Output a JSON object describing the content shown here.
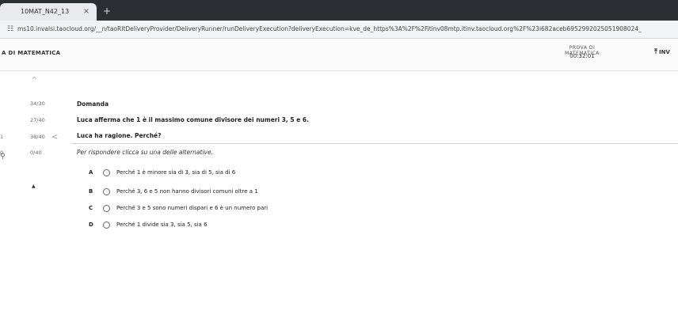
{
  "browser": {
    "tab_title": "10MAT_N42_13",
    "tab_close": "×",
    "new_tab": "+",
    "url": "ms10.invalsi.taocloud.org/__n/taoRItDeliveryProvider/DeliveryRunner/runDeliveryExecution?deliveryExecution=kve_de_https%3A%2F%2Fitinv08mtp.itinv.taocloud.org%2F%23i682aceb6952992025051908024_"
  },
  "app": {
    "title": "A DI MATEMATICA",
    "test_name": "PROVA DI MATEMATICA",
    "timer": "00:32:01",
    "send_label": "INV"
  },
  "rail": {
    "collapse": "^",
    "items": [
      {
        "marker": "",
        "label": "34/30"
      },
      {
        "marker": "",
        "label": "27/40"
      },
      {
        "marker": "1",
        "label": "38/40"
      },
      {
        "marker": "0",
        "label": "0/40"
      }
    ],
    "chevron": "<",
    "caret": "▲"
  },
  "question": {
    "label": "Domanda",
    "stem1": "Luca afferma che 1 è il massimo comune divisore dei numeri 3, 5 e 6.",
    "stem2": "Luca ha ragione. Perché?",
    "instruction": "Per rispondere clicca su una delle alternative.",
    "options": [
      {
        "letter": "A",
        "text": "Perché 1 è minore sia di 3, sia di 5, sia di 6"
      },
      {
        "letter": "B",
        "text": "Perché 3, 6 e 5 non hanno divisori comuni oltre a 1"
      },
      {
        "letter": "C",
        "text": "Perché 3 e 5 sono numeri dispari e 6 è un numero pari"
      },
      {
        "letter": "D",
        "text": "Perché 1 divide sia 3, sia 5, sia 6"
      }
    ]
  },
  "icons": {
    "address": "site-info-icon",
    "send": "send-icon",
    "person": "person-icon"
  }
}
